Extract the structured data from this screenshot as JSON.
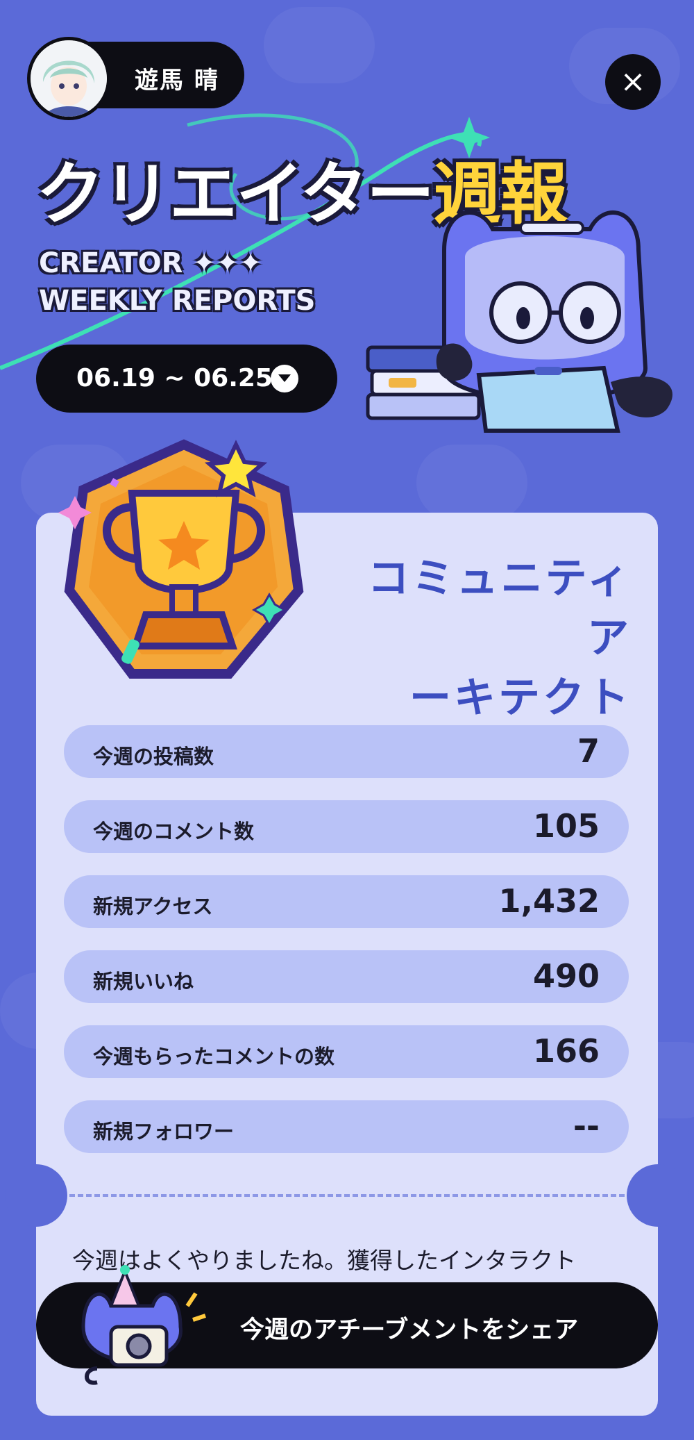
{
  "header": {
    "username": "遊馬 晴",
    "title_main": "クリエイター",
    "title_accent": "週報",
    "title_en_line1": "CREATOR ✦✦✦",
    "title_en_line2": "WEEKLY REPORTS",
    "date_range": "06.19 ~ 06.25"
  },
  "achievement": {
    "name_line1": "コミュニティア",
    "name_line2": "ーキテクト"
  },
  "stats": [
    {
      "label": "今週の投稿数",
      "value": "7"
    },
    {
      "label": "今週のコメント数",
      "value": "105"
    },
    {
      "label": "新規アクセス",
      "value": "1,432"
    },
    {
      "label": "新規いいね",
      "value": "490"
    },
    {
      "label": "今週もらったコメントの数",
      "value": "166"
    },
    {
      "label": "新規フォロワー",
      "value": "--"
    }
  ],
  "summary": {
    "text": "今週はよくやりましたね。獲得したインタラクト"
  },
  "share": {
    "label": "今週のアチーブメントをシェア"
  },
  "colors": {
    "background": "#5b6ad8",
    "card": "#dde0fb",
    "stat_row": "#b9c2f7",
    "accent_blue": "#3c4ec0",
    "accent_yellow": "#ffd43b"
  },
  "icons": [
    "close-icon",
    "chevron-down-icon",
    "trophy-icon",
    "mascot-illustration"
  ]
}
